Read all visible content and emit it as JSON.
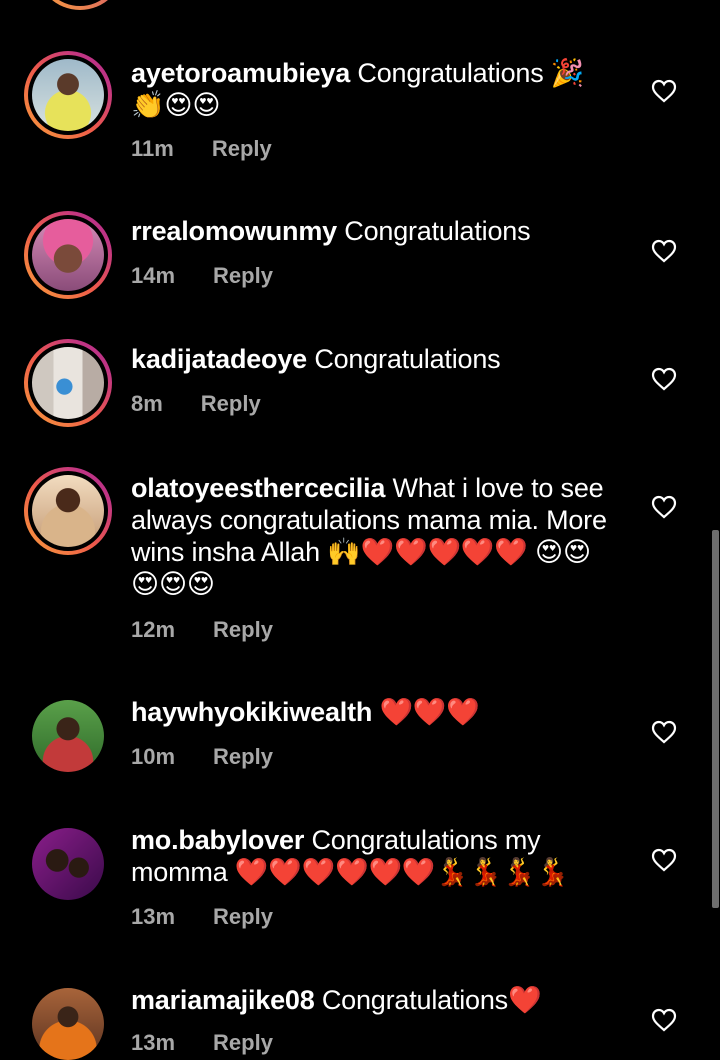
{
  "comments": [
    {
      "username": "ayetoroamubieya",
      "text": "Congratulations 🎉 👏😍😍",
      "time": "11m",
      "reply": "Reply"
    },
    {
      "username": "rrealomowunmy",
      "text": "Congratulations",
      "time": "14m",
      "reply": "Reply"
    },
    {
      "username": "kadijatadeoye",
      "text": "Congratulations",
      "time": "8m",
      "reply": "Reply"
    },
    {
      "username": "olatoyeesthercecilia",
      "text": "What i love to see always congratulations mama mia. More wins insha Allah 🙌❤️❤️❤️❤️❤️ 😍😍😍😍😍",
      "time": "12m",
      "reply": "Reply"
    },
    {
      "username": "haywhyokikiwealth",
      "text": "❤️❤️❤️",
      "time": "10m",
      "reply": "Reply"
    },
    {
      "username": "mo.babylover",
      "text": "Congratulations my momma ❤️❤️❤️❤️❤️❤️💃💃💃💃",
      "time": "13m",
      "reply": "Reply"
    },
    {
      "username": "mariamajike08",
      "text": "Congratulations❤️",
      "time": "13m",
      "reply": "Reply"
    }
  ],
  "icons": {
    "like": "heart-outline-icon"
  },
  "colors": {
    "background": "#000000",
    "text": "#ffffff",
    "meta": "#a8a8a8",
    "story_ring_start": "#f9a03c",
    "story_ring_end": "#c13584"
  }
}
